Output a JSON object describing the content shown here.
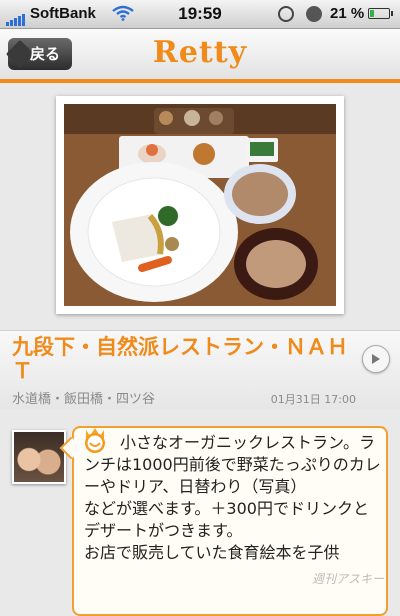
{
  "status_bar": {
    "carrier": "SoftBank",
    "time": "19:59",
    "battery_percent": "21 %",
    "battery_level": 0.21
  },
  "nav": {
    "back_label": "戻る",
    "logo_text": "Retty"
  },
  "post": {
    "title": "九段下・自然派レストラン・ＮＡＨＴ",
    "location": "水道橋・飯田橋・四ツ谷",
    "datetime": "01月31日 17:00",
    "comment": "小さなオーガニックレストラン。ランチは1000円前後で野菜たっぷりのカレーやドリア、日替わり（写真）\nなどが選べます。＋300円でドリンクとデザートがつきます。\nお店で販売していた食育絵本を子供"
  },
  "watermark": "週刊アスキー",
  "colors": {
    "accent": "#f08a1a",
    "bubble_border": "#f0a030"
  },
  "icons": [
    "signal-icon",
    "wifi-icon",
    "lock-rotation-icon",
    "alarm-icon",
    "battery-icon",
    "chevron-right-icon",
    "smiley-icon"
  ]
}
